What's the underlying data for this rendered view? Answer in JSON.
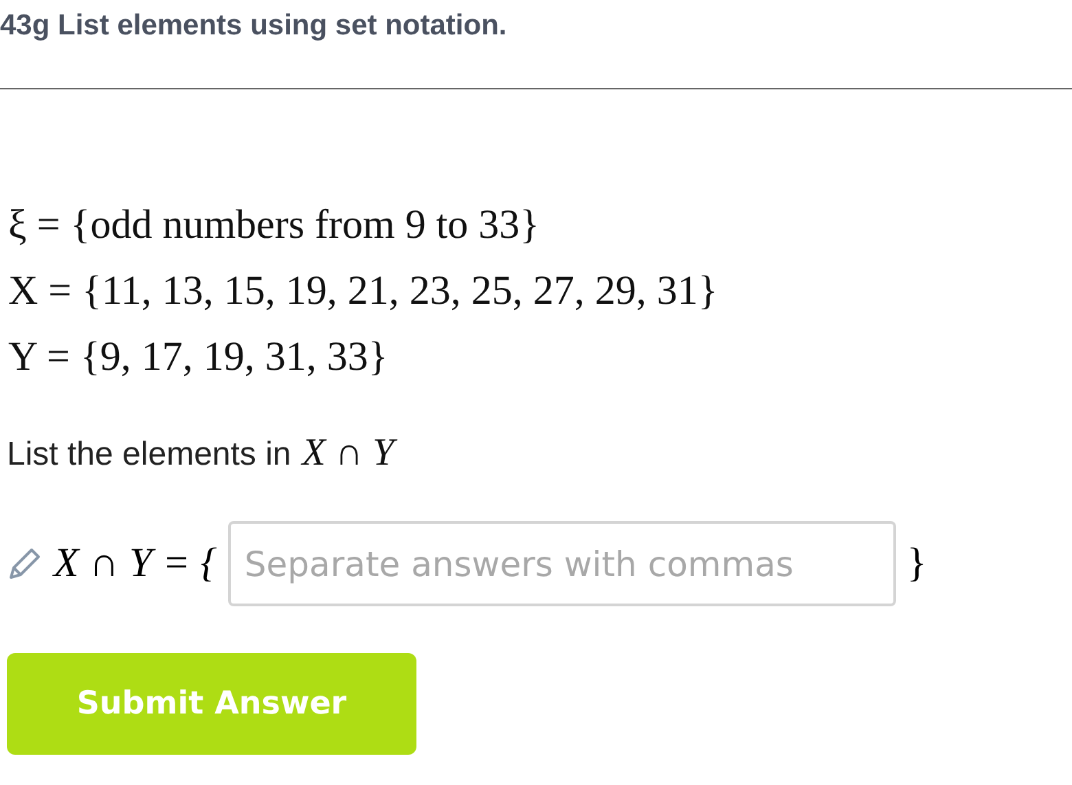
{
  "title": "43g List elements using set notation.",
  "sets": [
    "ξ = {odd numbers from 9 to 33}",
    "X = {11, 13, 15, 19, 21, 23, 25, 27, 29, 31}",
    "Y = {9, 17, 19, 31, 33}"
  ],
  "prompt": {
    "text": "List the elements in",
    "math": "X ∩ Y"
  },
  "answer": {
    "label": "X ∩ Y = {",
    "close": "}",
    "placeholder": "Separate answers with commas"
  },
  "submit_button": "Submit Answer"
}
